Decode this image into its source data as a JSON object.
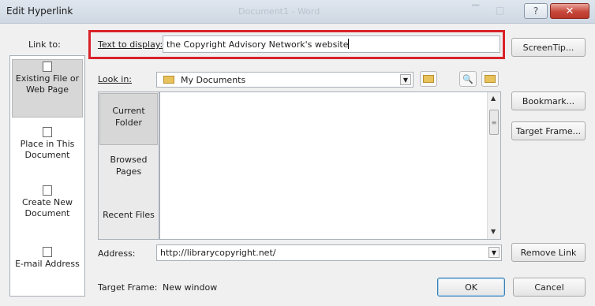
{
  "window": {
    "title": "Edit Hyperlink",
    "background_title": "Document1 - Word",
    "help_glyph": "?",
    "close_glyph": "✕",
    "minimize_glyph": "▔",
    "maximize_glyph": "□"
  },
  "dialog": {
    "link_to_label": "Link to:",
    "text_to_display_label": "Text to display:",
    "text_to_display_value": "the Copyright Advisory Network's website",
    "look_in_label": "Look in:",
    "look_in_value": "My Documents",
    "address_label": "Address:",
    "address_value": "http://librarycopyright.net/",
    "target_frame_label": "Target Frame:",
    "target_frame_value": "New window",
    "highlight_color": "#d9222a"
  },
  "link_to_items": [
    {
      "label": "Existing File or Web Page",
      "selected": true,
      "icon": "existing-file-icon"
    },
    {
      "label": "Place in This Document",
      "selected": false,
      "icon": "place-in-document-icon"
    },
    {
      "label": "Create New Document",
      "selected": false,
      "icon": "create-new-document-icon"
    },
    {
      "label": "E-mail Address",
      "selected": false,
      "icon": "email-address-icon"
    }
  ],
  "places": [
    {
      "label": "Current Folder",
      "selected": true
    },
    {
      "label": "Browsed Pages",
      "selected": false
    },
    {
      "label": "Recent Files",
      "selected": false
    }
  ],
  "buttons": {
    "screentip": "ScreenTip...",
    "bookmark": "Bookmark...",
    "target_frame": "Target Frame...",
    "remove_link": "Remove Link",
    "ok": "OK",
    "cancel": "Cancel"
  },
  "icons": {
    "dropdown": "▼",
    "scroll_up": "▲",
    "scroll_down": "▼",
    "scroll_grip": "≡",
    "browse_web": "🔍"
  }
}
